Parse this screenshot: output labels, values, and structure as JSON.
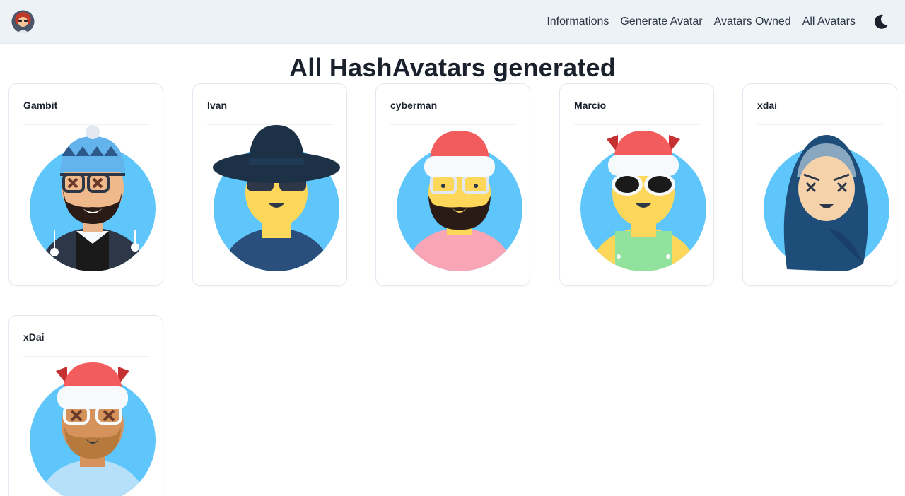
{
  "navbar": {
    "logo_icon": "avatar-logo-icon",
    "links": [
      {
        "label": "Informations"
      },
      {
        "label": "Generate Avatar"
      },
      {
        "label": "Avatars Owned"
      },
      {
        "label": "All Avatars"
      }
    ],
    "theme_icon": "moon-icon"
  },
  "page": {
    "title": "All HashAvatars generated"
  },
  "avatars": [
    {
      "name": "Gambit",
      "icon": "avatar-beanie-bearded-icon"
    },
    {
      "name": "Ivan",
      "icon": "avatar-hat-sunglasses-icon"
    },
    {
      "name": "cyberman",
      "icon": "avatar-santa-bearded-icon"
    },
    {
      "name": "Marcio",
      "icon": "avatar-santa-sunglasses-icon"
    },
    {
      "name": "xdai",
      "icon": "avatar-hijab-icon"
    },
    {
      "name": "xDai",
      "icon": "avatar-santa-beard-tan-icon"
    }
  ],
  "colors": {
    "navbar_bg": "#edf2f7",
    "avatar_bg": "#5ec6fa",
    "skin_yellow": "#fdd75a",
    "santa_red": "#f25c5c"
  }
}
